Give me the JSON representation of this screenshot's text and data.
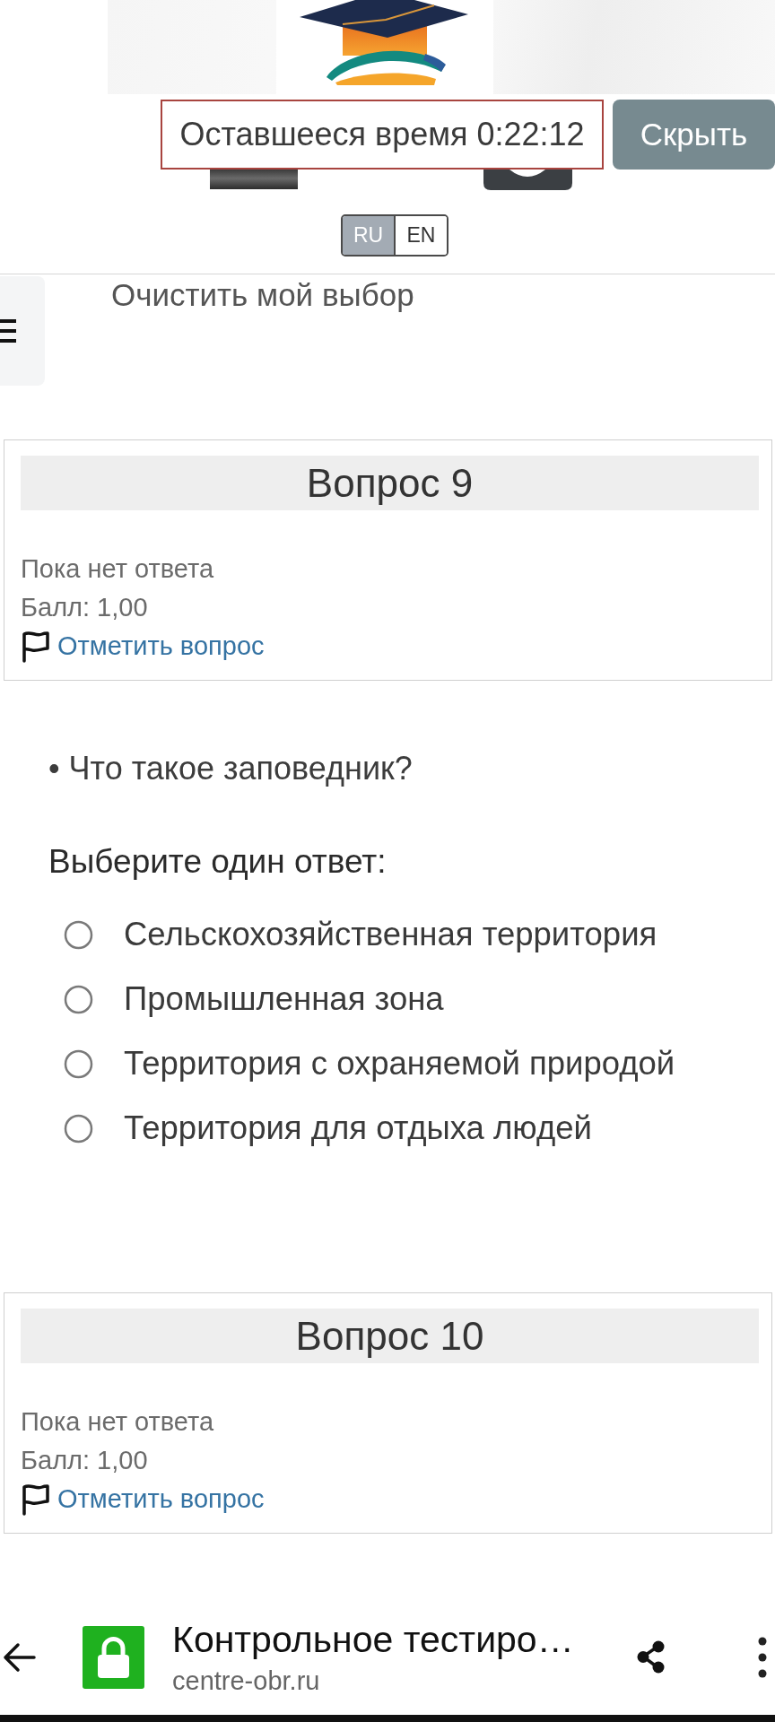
{
  "header": {
    "timer": "Оставшееся время 0:22:12",
    "hide_button": "Скрыть",
    "languages": [
      {
        "label": "RU",
        "selected": true
      },
      {
        "label": "EN",
        "selected": false
      }
    ]
  },
  "clear_choice_link": "Очистить мой выбор",
  "questions": [
    {
      "title": "Вопрос 9",
      "status": "Пока нет ответа",
      "score": "Балл: 1,00",
      "flag_link": "Отметить вопрос",
      "text": "• Что такое заповедник?",
      "prompt": "Выберите один ответ:",
      "options": [
        {
          "label": "Сельскохозяйственная территория",
          "selected": false
        },
        {
          "label": "Промышленная зона",
          "selected": false
        },
        {
          "label": "Территория с охраняемой природой",
          "selected": false
        },
        {
          "label": "Территория для отдыха людей",
          "selected": false
        }
      ]
    },
    {
      "title": "Вопрос 10",
      "status": "Пока нет ответа",
      "score": "Балл: 1,00",
      "flag_link": "Отметить вопрос"
    }
  ],
  "browser_bar": {
    "title": "Контрольное тестиро…",
    "url": "centre-obr.ru"
  }
}
